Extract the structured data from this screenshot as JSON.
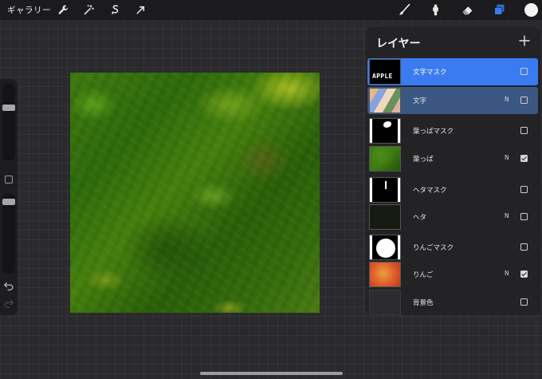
{
  "topbar": {
    "gallery_label": "ギャラリー",
    "left_tools": [
      "wrench-icon",
      "magic-wand-icon",
      "selection-icon",
      "transform-arrow-icon"
    ],
    "right_tools": [
      "brush-icon",
      "smudge-icon",
      "eraser-icon",
      "layers-icon"
    ],
    "active_color": "#f4f4f4",
    "accent_color": "#3a7bf2"
  },
  "sidebar": {
    "brush_size": 0.2,
    "opacity": 0.08
  },
  "layers_panel": {
    "title": "レイヤー",
    "layers": [
      {
        "name": "文字マスク",
        "blend": "",
        "visible": false,
        "state": "active"
      },
      {
        "name": "文字",
        "blend": "N",
        "visible": false,
        "state": "secondary"
      },
      {
        "name": "葉っぱマスク",
        "blend": "",
        "visible": false,
        "state": ""
      },
      {
        "name": "葉っぱ",
        "blend": "N",
        "visible": true,
        "state": ""
      },
      {
        "name": "ヘタマスク",
        "blend": "",
        "visible": false,
        "state": ""
      },
      {
        "name": "ヘタ",
        "blend": "N",
        "visible": false,
        "state": ""
      },
      {
        "name": "りんごマスク",
        "blend": "",
        "visible": false,
        "state": ""
      },
      {
        "name": "りんご",
        "blend": "N",
        "visible": true,
        "state": ""
      },
      {
        "name": "背景色",
        "blend": "",
        "visible": false,
        "state": ""
      }
    ],
    "mask_thumbnail_text": "APPLE"
  }
}
